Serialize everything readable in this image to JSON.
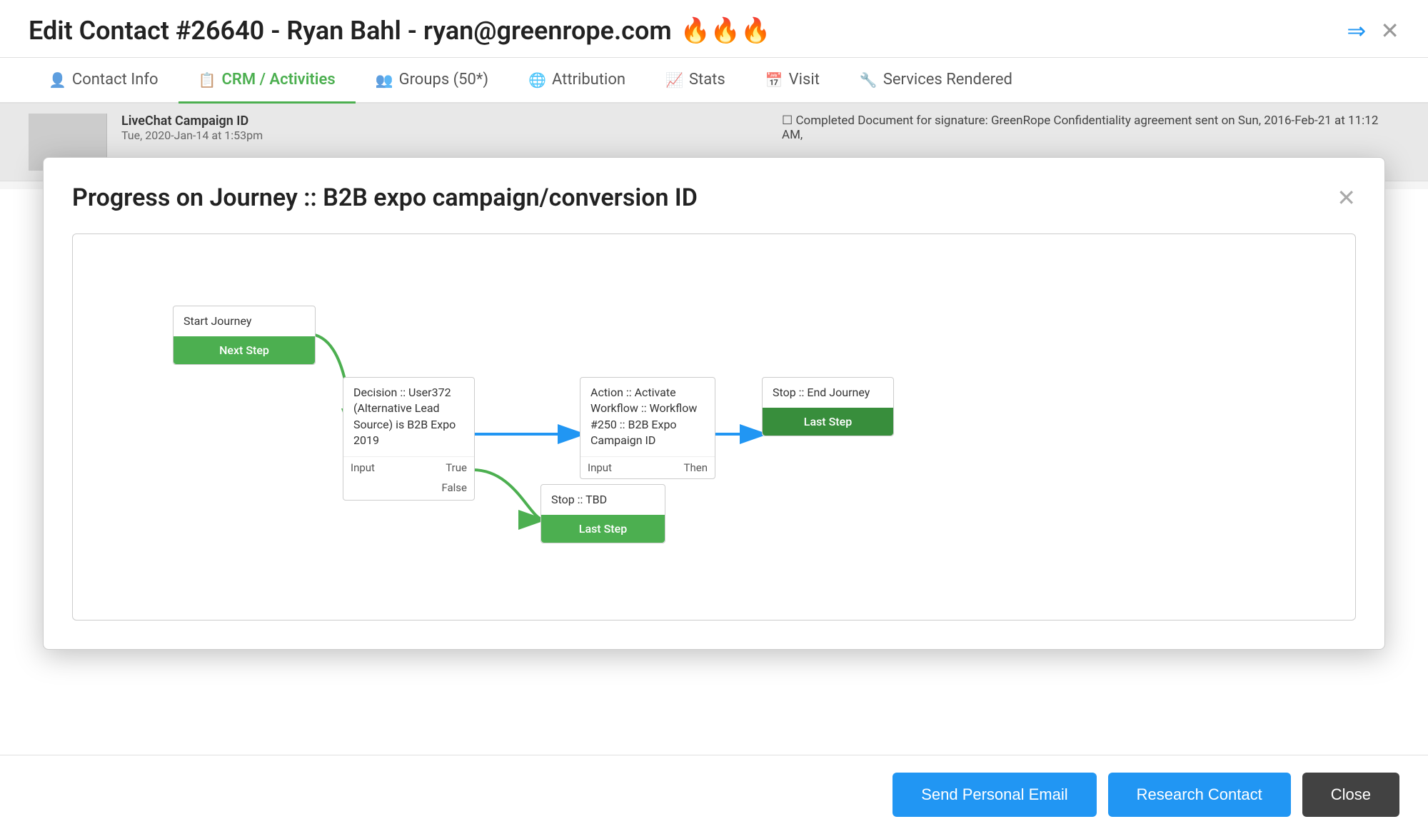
{
  "header": {
    "title": "Edit Contact #26640 - Ryan Bahl - ryan@greenrope.com",
    "fire_icons": "🔥🔥🔥",
    "arrow_symbol": "⇒",
    "close_symbol": "✕"
  },
  "tabs": [
    {
      "id": "contact-info",
      "icon": "👤",
      "label": "Contact Info",
      "active": false
    },
    {
      "id": "crm-activities",
      "icon": "📋",
      "label": "CRM / Activities",
      "active": true
    },
    {
      "id": "groups",
      "icon": "👥",
      "label": "Groups (50*)",
      "active": false
    },
    {
      "id": "attribution",
      "icon": "🌐",
      "label": "Attribution",
      "active": false
    },
    {
      "id": "stats",
      "icon": "📈",
      "label": "Stats",
      "active": false
    },
    {
      "id": "visit",
      "icon": "📅",
      "label": "Visit",
      "active": false
    },
    {
      "id": "services-rendered",
      "icon": "🔧",
      "label": "Services Rendered",
      "active": false
    }
  ],
  "bg_row": {
    "label": "LiveChat Campaign ID",
    "date": "Tue, 2020-Jan-14 at 1:53pm",
    "right_text": "☐ Completed Document for signature: GreenRope Confidentiality agreement sent on Sun, 2016-Feb-21 at 11:12 AM,"
  },
  "modal": {
    "title": "Progress on Journey :: B2B expo campaign/conversion ID",
    "close_symbol": "✕",
    "nodes": {
      "start": {
        "label": "Start Journey",
        "button": "Next Step"
      },
      "decision": {
        "label": "Decision :: User372 (Alternative Lead Source) is B2B Expo 2019",
        "input_label": "Input",
        "true_label": "True",
        "false_label": "False"
      },
      "action": {
        "label": "Action :: Activate Workflow :: Workflow #250 :: B2B Expo Campaign ID",
        "input_label": "Input",
        "then_label": "Then"
      },
      "stop_end": {
        "label": "Stop :: End Journey",
        "button": "Last Step"
      },
      "stop_tbd": {
        "label": "Stop :: TBD",
        "button": "Last Step"
      }
    }
  },
  "footer": {
    "send_email_label": "Send Personal Email",
    "research_label": "Research Contact",
    "close_label": "Close"
  }
}
